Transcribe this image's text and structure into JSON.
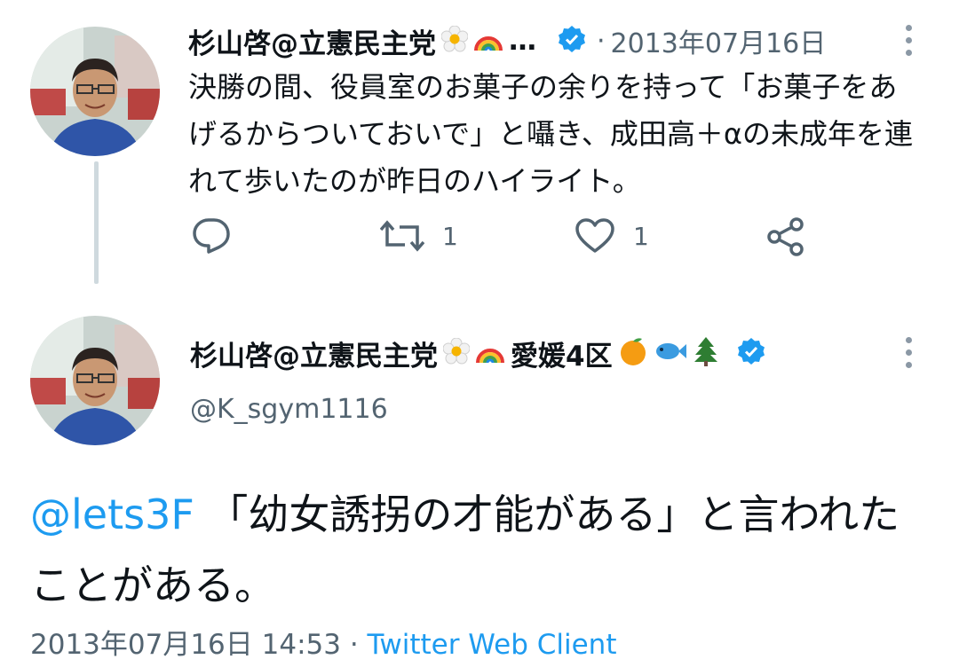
{
  "reply_tweet": {
    "author_name": "杉山啓@立憲民主党",
    "author_suffix": "…",
    "dot": "·",
    "date": "2013年07月16日",
    "text": "決勝の間、役員室のお菓子の余りを持って「お菓子をあげるからついておいで」と囁き、成田高＋αの未成年を連れて歩いたのが昨日のハイライト。",
    "retweet_count": "1",
    "like_count": "1",
    "icons": [
      "reply-icon",
      "retweet-icon",
      "like-icon",
      "share-icon"
    ]
  },
  "main_tweet": {
    "author_name": "杉山啓@立憲民主党",
    "author_tag": "愛媛4区",
    "handle": "@K_sgym1116",
    "mention": "@lets3F",
    "text": " 「幼女誘拐の才能がある」と言われたことがある。",
    "timestamp": "2013年07月16日 14:53",
    "separator": " · ",
    "client": "Twitter Web Client"
  },
  "colors": {
    "accent": "#1d9bf0",
    "text": "#0f1419",
    "secondary": "#536471",
    "thread_line": "#cfd9de"
  }
}
